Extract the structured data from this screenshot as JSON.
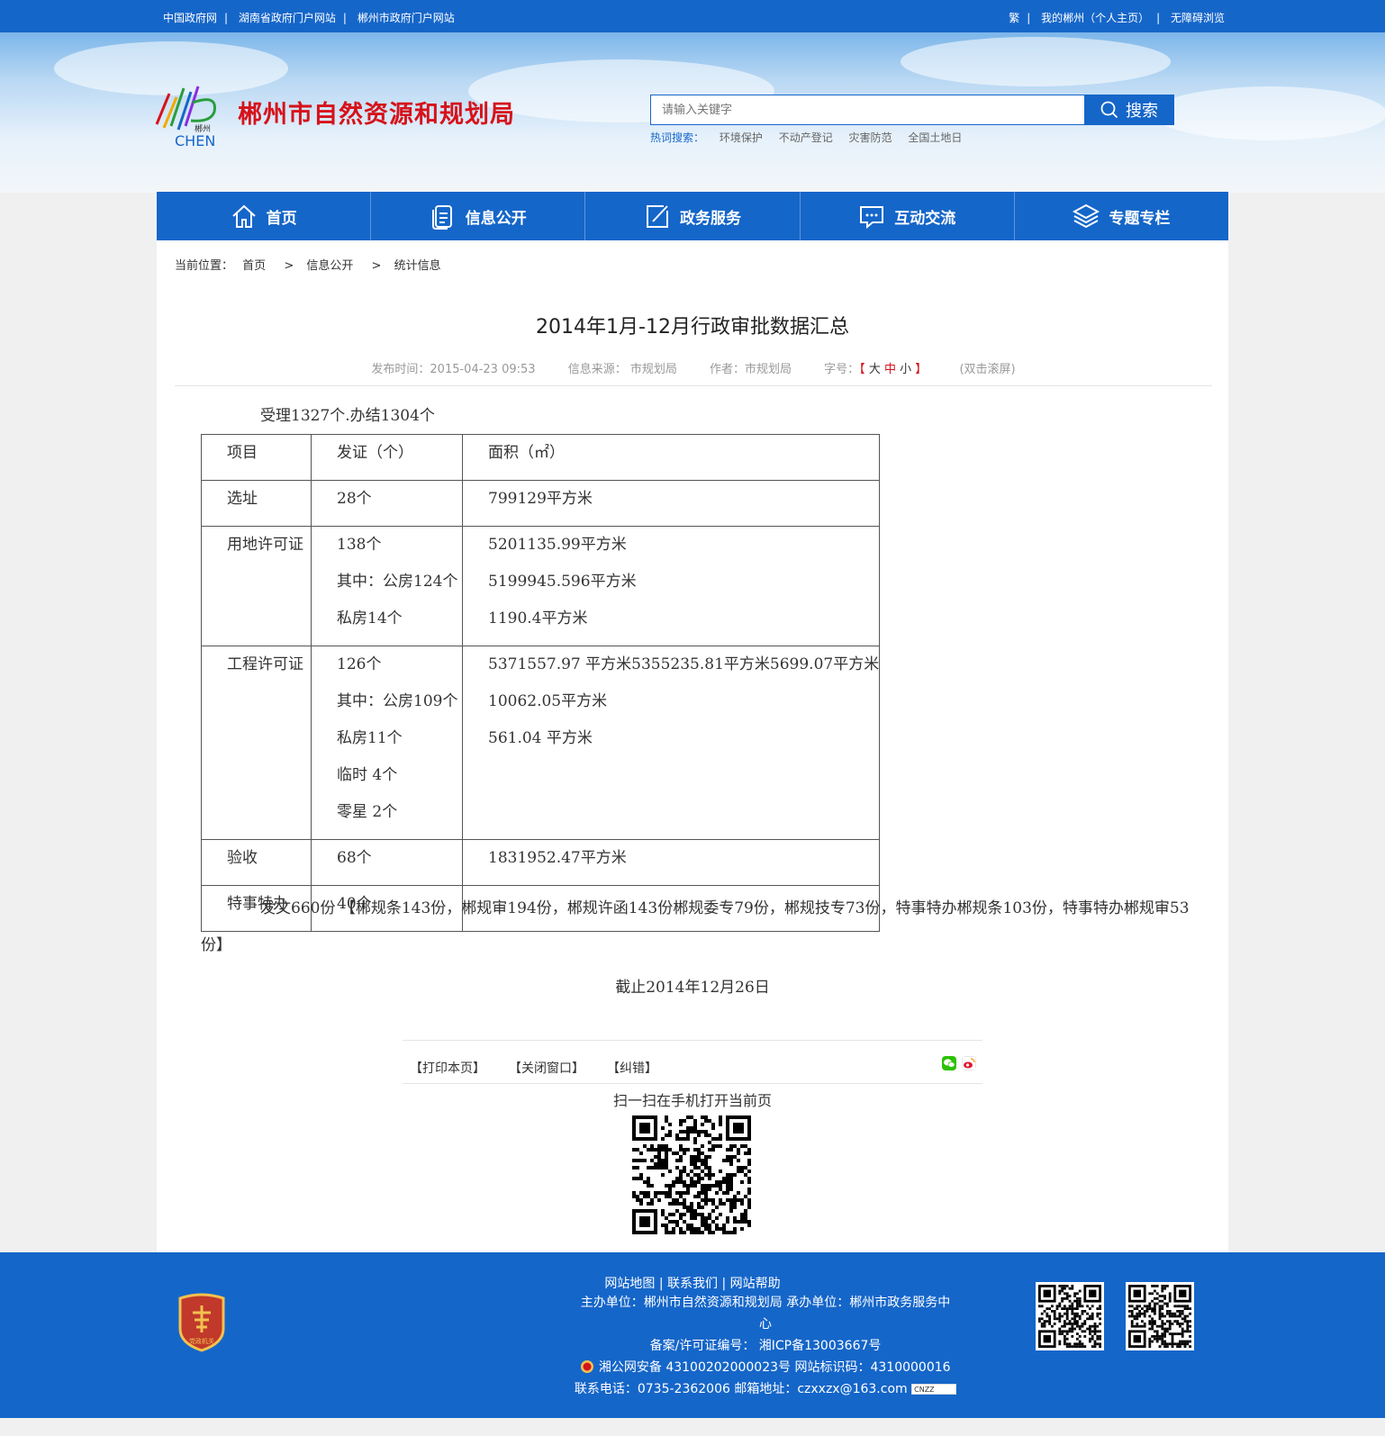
{
  "topbar": {
    "links": [
      "中国政府网",
      "湖南省政府门户网站",
      "郴州市政府门户网站"
    ],
    "right_links": [
      "繁",
      "我的郴州（个人主页）",
      "无障碍浏览"
    ]
  },
  "header": {
    "site_title": "郴州市自然资源和规划局",
    "logo_text": "CHEN",
    "logo_small": "郴州",
    "search_placeholder": "请输入关键字",
    "search_button": "搜索",
    "hot_label": "热词搜索：",
    "hot_words": [
      "环境保护",
      "不动产登记",
      "灾害防范",
      "全国土地日"
    ]
  },
  "nav": {
    "items": [
      {
        "label": "首页",
        "icon": "home-icon"
      },
      {
        "label": "信息公开",
        "icon": "document-icon"
      },
      {
        "label": "政务服务",
        "icon": "edit-icon"
      },
      {
        "label": "互动交流",
        "icon": "chat-icon"
      },
      {
        "label": "专题专栏",
        "icon": "layers-icon"
      }
    ]
  },
  "breadcrumb": {
    "label": "当前位置：",
    "items": [
      "首页",
      "信息公开",
      "统计信息"
    ],
    "separator": ">"
  },
  "article": {
    "title": "2014年1月-12月行政审批数据汇总",
    "publish_time": "发布时间：2015-04-23 09:53",
    "source": "信息来源： 市规划局",
    "author": "作者：市规划局",
    "font_label": "字号：",
    "font_open": "【",
    "font_large": "大",
    "font_medium": "中",
    "font_small": "小",
    "font_close": "】",
    "dblclick": "(双击滚屏)",
    "intro": "受理1327个.办结1304个",
    "table": {
      "headers": [
        "项目",
        "发证（个）",
        "面积（㎡）"
      ],
      "rows": [
        {
          "item": "选址",
          "certs": [
            "28个"
          ],
          "areas": [
            "799129平方米"
          ]
        },
        {
          "item": "用地许可证",
          "certs": [
            "138个",
            "其中：公房124个",
            "私房14个"
          ],
          "areas": [
            "5201135.99平方米",
            "5199945.596平方米",
            "1190.4平方米"
          ]
        },
        {
          "item": "工程许可证",
          "certs": [
            "126个",
            "其中：公房109个",
            "私房11个",
            "临时 4个",
            "零星 2个"
          ],
          "areas": [
            "5371557.97 平方米5355235.81平方米5699.07平方米",
            "10062.05平方米",
            "561.04 平方米"
          ]
        },
        {
          "item": "验收",
          "certs": [
            "68个"
          ],
          "areas": [
            "1831952.47平方米"
          ]
        },
        {
          "item": "特事特办",
          "certs": [
            "40个"
          ],
          "areas": [
            ""
          ]
        }
      ]
    },
    "dispatch": "发文660份 【郴规条143份，郴规审194份，郴规许函143份郴规委专79份，郴规技专73份，特事特办郴规条103份，特事特办郴规审53份】",
    "deadline": "截止2014年12月26日"
  },
  "tools": {
    "print": "【打印本页】",
    "close": "【关闭窗口】",
    "correct": "【纠错】",
    "qr_caption": "扫一扫在手机打开当前页",
    "share_icons": [
      "wechat-icon",
      "weibo-icon"
    ]
  },
  "footer": {
    "links": [
      "网站地图",
      "联系我们",
      "网站帮助"
    ],
    "sponsor": "主办单位：郴州市自然资源和规划局    承办单位：郴州市政务服务中",
    "sponsor_cont": "心",
    "icp": "备案/许可证编号： 湘ICP备13003667号",
    "police": "湘公网安备 43100202000023号    网站标识码：4310000016",
    "contact": "联系电话：0735-2362006    邮箱地址：czxxzx@163.com",
    "badge_text": "党政机关",
    "cnzz": "CNZZ"
  },
  "colors": {
    "primary": "#1566c9",
    "title_red": "#d6121b"
  }
}
